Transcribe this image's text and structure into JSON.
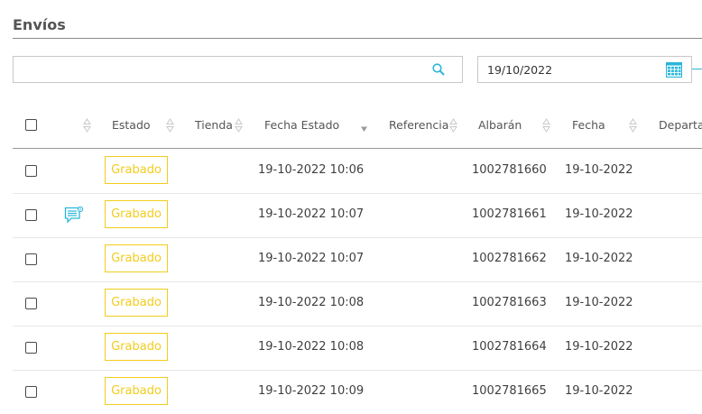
{
  "page": {
    "title": "Envíos"
  },
  "search": {
    "value": "",
    "placeholder": "",
    "icon": "search-icon"
  },
  "date_filter": {
    "value": "19/10/2022",
    "icon": "calendar-icon"
  },
  "colors": {
    "accent": "#29b6d8",
    "badge": "#f2cc1c"
  },
  "table": {
    "columns": {
      "estado": "Estado",
      "tienda": "Tienda",
      "fecha_estado": "Fecha Estado",
      "referencia": "Referencia",
      "albaran": "Albarán",
      "fecha": "Fecha",
      "departamento": "Departa"
    },
    "rows": [
      {
        "estado": "Grabado",
        "fecha_estado": "19-10-2022 10:06",
        "albaran": "1002781660",
        "fecha": "19-10-2022",
        "has_message": false
      },
      {
        "estado": "Grabado",
        "fecha_estado": "19-10-2022 10:07",
        "albaran": "1002781661",
        "fecha": "19-10-2022",
        "has_message": true
      },
      {
        "estado": "Grabado",
        "fecha_estado": "19-10-2022 10:07",
        "albaran": "1002781662",
        "fecha": "19-10-2022",
        "has_message": false
      },
      {
        "estado": "Grabado",
        "fecha_estado": "19-10-2022 10:08",
        "albaran": "1002781663",
        "fecha": "19-10-2022",
        "has_message": false
      },
      {
        "estado": "Grabado",
        "fecha_estado": "19-10-2022 10:08",
        "albaran": "1002781664",
        "fecha": "19-10-2022",
        "has_message": false
      },
      {
        "estado": "Grabado",
        "fecha_estado": "19-10-2022 10:09",
        "albaran": "1002781665",
        "fecha": "19-10-2022",
        "has_message": false
      }
    ]
  }
}
